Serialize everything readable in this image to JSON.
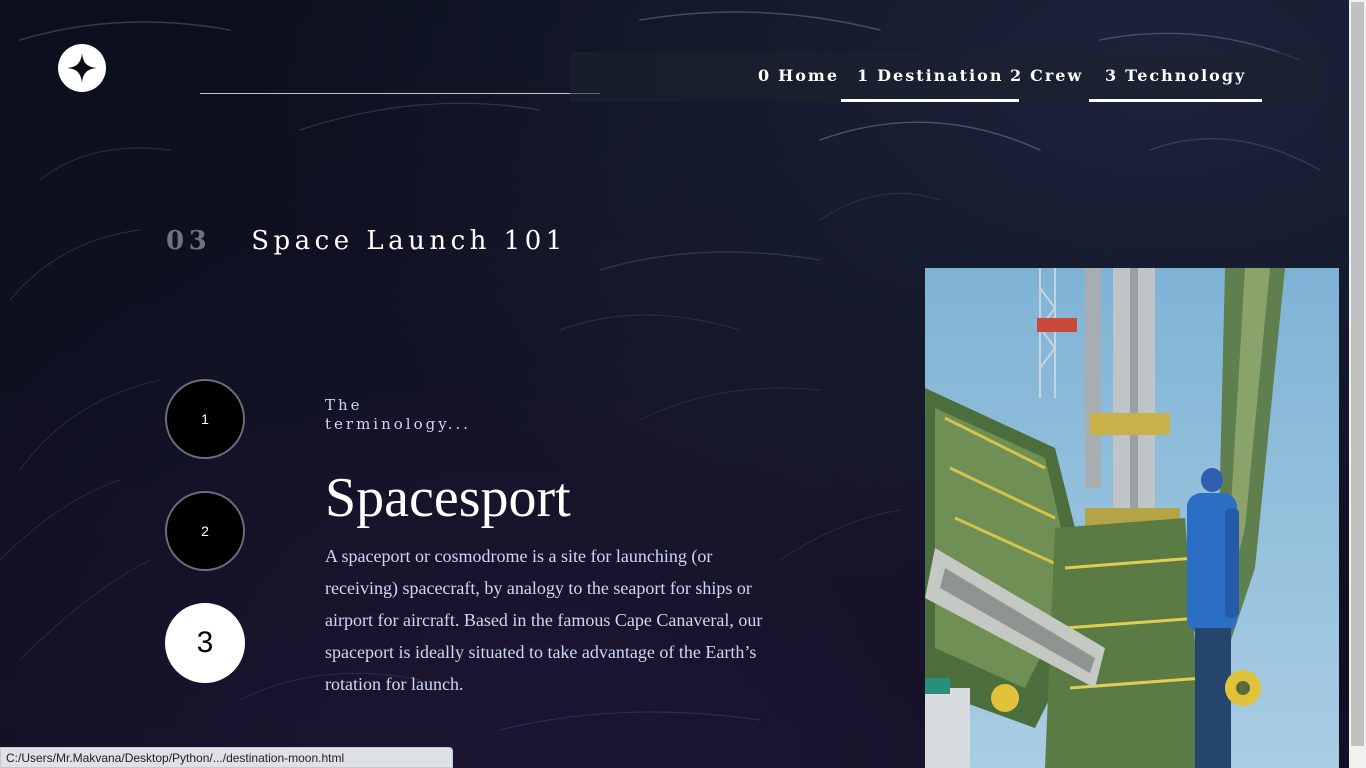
{
  "nav": {
    "items": [
      {
        "num": "0",
        "label": "Home"
      },
      {
        "num": "1",
        "label": "Destination"
      },
      {
        "num": "2",
        "label": "Crew"
      },
      {
        "num": "3",
        "label": "Technology"
      }
    ]
  },
  "section": {
    "num": "03",
    "title": "Space Launch 101"
  },
  "steps": [
    "1",
    "2",
    "3"
  ],
  "content": {
    "eyebrow": "The terminology...",
    "name": "Spacesport",
    "description": "A spaceport or cosmodrome is a site for launching (or receiving) spacecraft, by analogy to the seaport for ships or airport for aircraft. Based in the famous Cape Canaveral, our spaceport is ideally situated to take advantage of the Earth’s rotation for launch."
  },
  "status_bar": {
    "url": "C:/Users/Mr.Makvana/Desktop/Python/.../destination-moon.html"
  },
  "colors": {
    "background": "#0b0d17",
    "accent": "#ffffff",
    "text_muted": "#d0d6f9"
  },
  "icons": {
    "logo": "four-point-star-icon"
  }
}
